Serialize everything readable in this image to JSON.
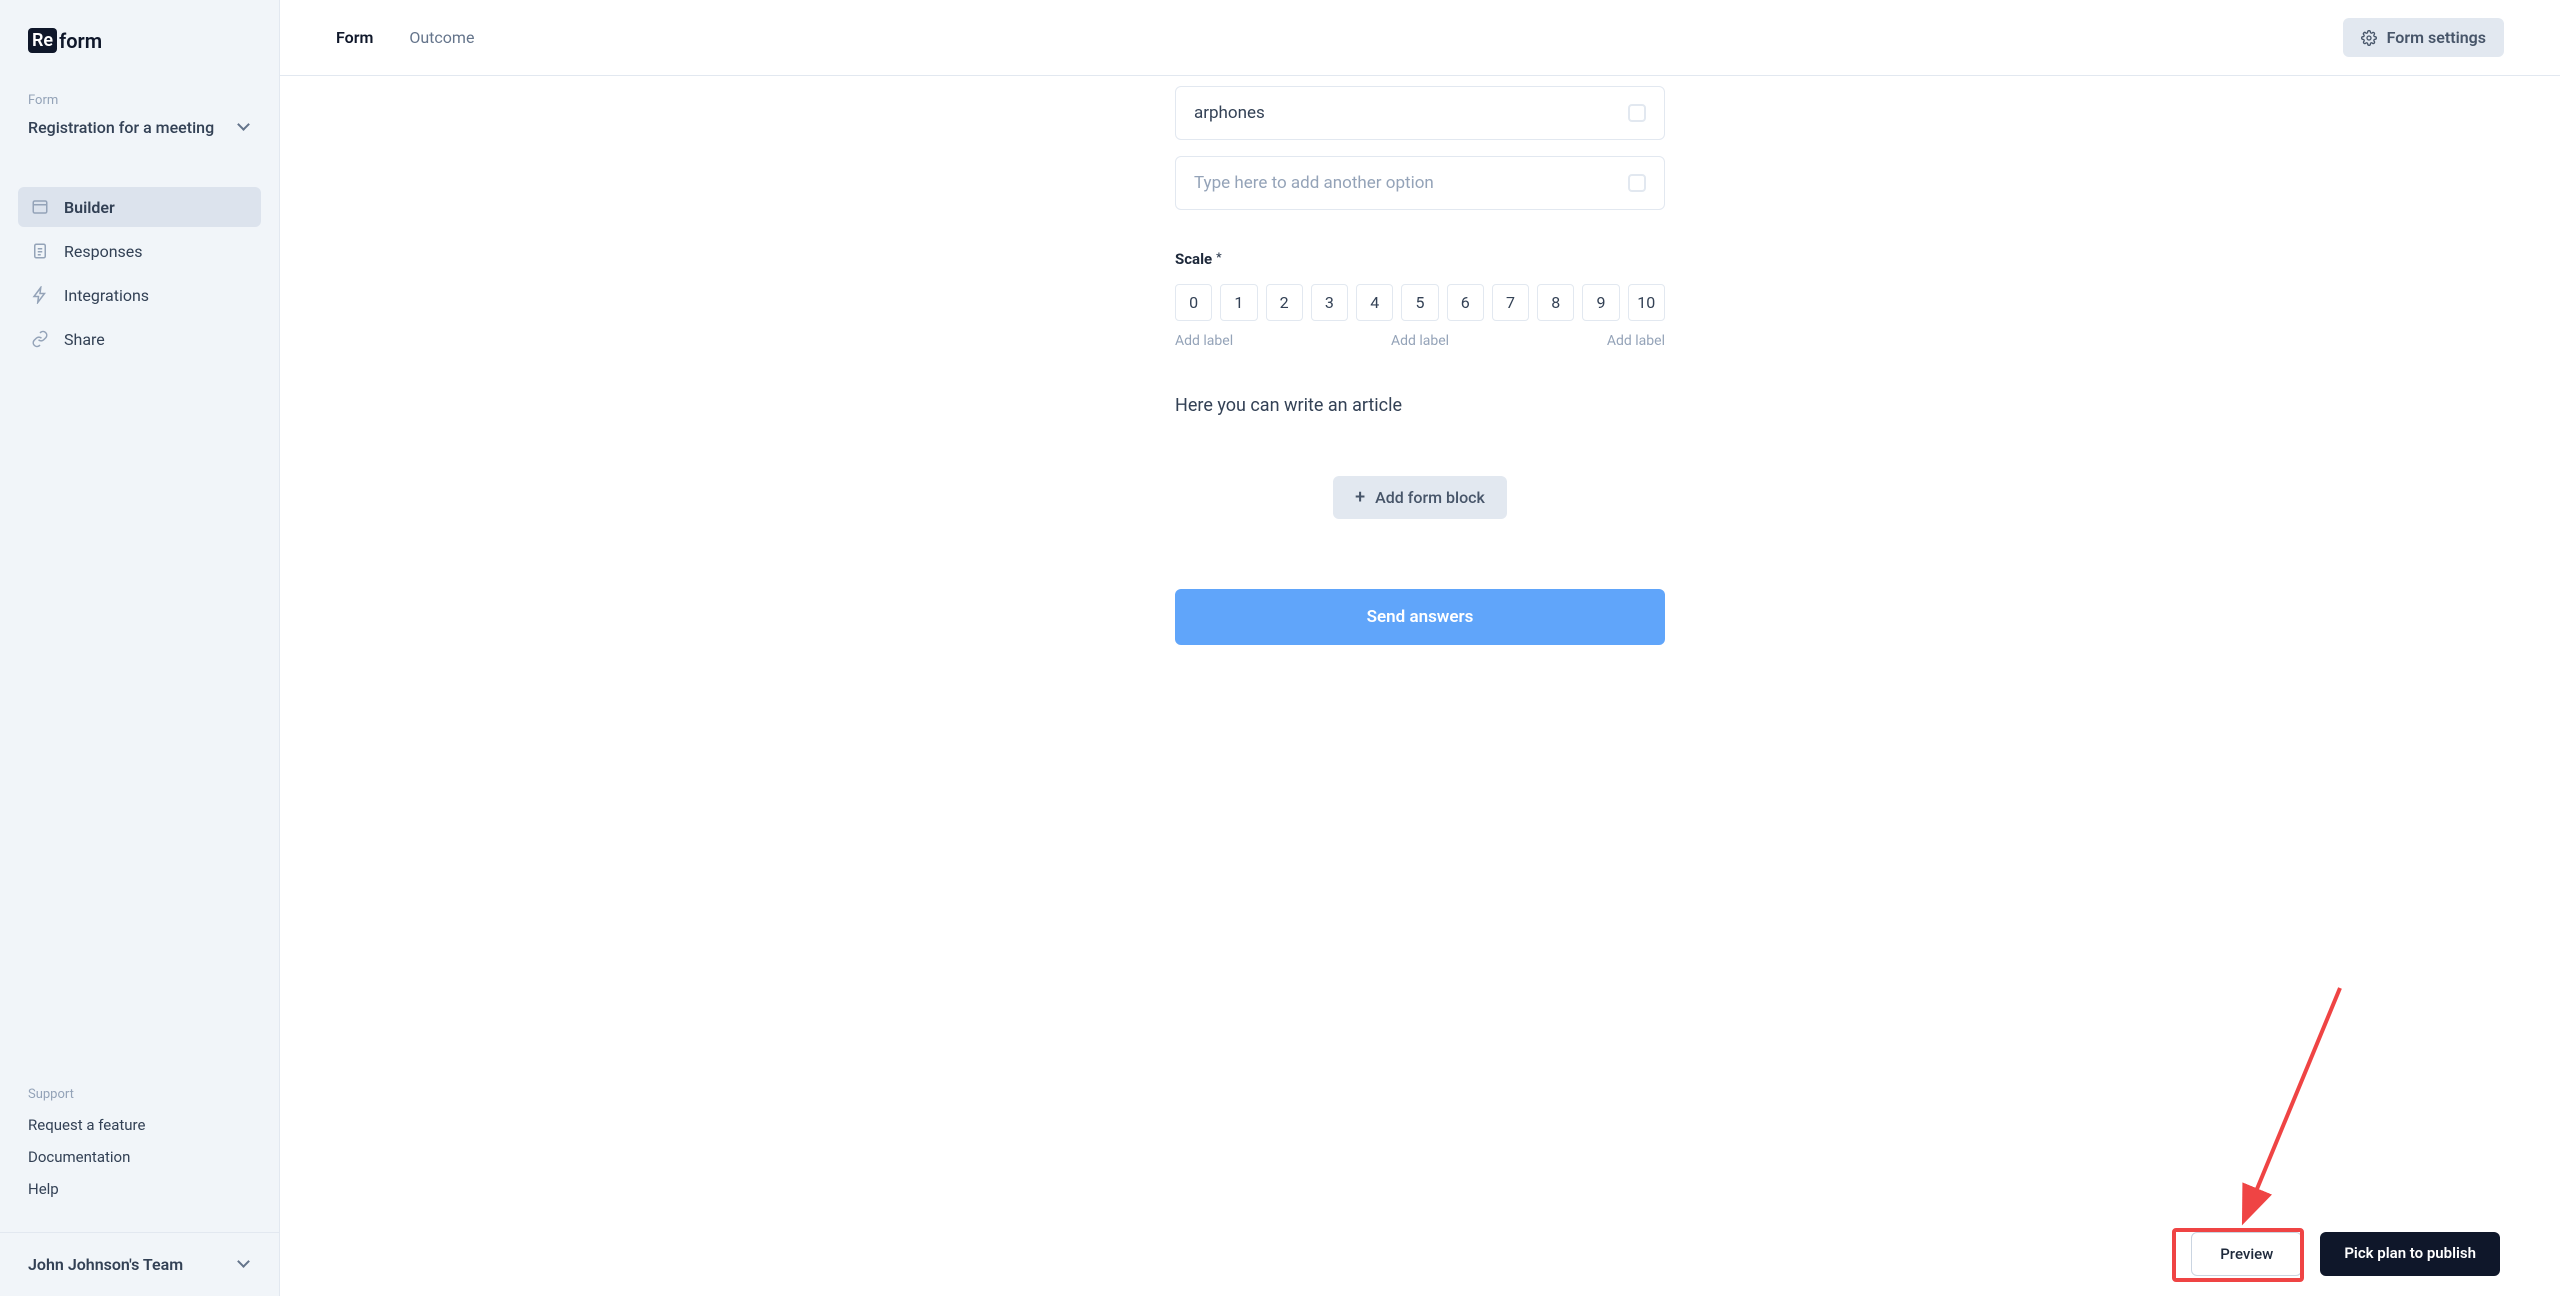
{
  "logo": {
    "prefix": "Re",
    "suffix": "form"
  },
  "sidebar": {
    "section_label": "Form",
    "form_name": "Registration for a meeting",
    "nav": [
      {
        "label": "Builder"
      },
      {
        "label": "Responses"
      },
      {
        "label": "Integrations"
      },
      {
        "label": "Share"
      }
    ],
    "support_label": "Support",
    "footer_links": [
      {
        "label": "Request a feature"
      },
      {
        "label": "Documentation"
      },
      {
        "label": "Help"
      }
    ],
    "team": "John Johnson's Team"
  },
  "topbar": {
    "tabs": [
      {
        "label": "Form"
      },
      {
        "label": "Outcome"
      }
    ],
    "settings_label": "Form settings"
  },
  "builder": {
    "option_value": "arphones",
    "option_placeholder": "Type here to add another option",
    "scale_label": "Scale",
    "scale_values": [
      "0",
      "1",
      "2",
      "3",
      "4",
      "5",
      "6",
      "7",
      "8",
      "9",
      "10"
    ],
    "add_label_text": "Add label",
    "text_block": "Here you can write an article",
    "add_block_label": "Add form block",
    "submit_label": "Send answers"
  },
  "bottom": {
    "preview": "Preview",
    "publish": "Pick plan to publish"
  }
}
